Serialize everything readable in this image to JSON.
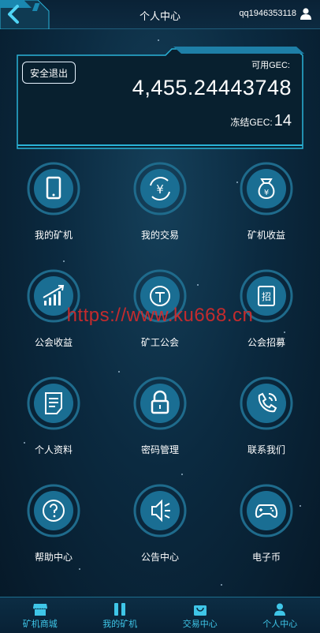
{
  "header": {
    "title": "个人中心",
    "username": "qq1946353118"
  },
  "balance": {
    "logout_label": "安全退出",
    "available_label": "可用GEC:",
    "available_value": "4,455.24443748",
    "frozen_label": "冻结GEC:",
    "frozen_value": "14"
  },
  "menu": [
    {
      "label": "我的矿机",
      "icon": "tablet-icon"
    },
    {
      "label": "我的交易",
      "icon": "yuan-exchange-icon"
    },
    {
      "label": "矿机收益",
      "icon": "money-bag-icon"
    },
    {
      "label": "公会收益",
      "icon": "growth-chart-icon"
    },
    {
      "label": "矿工公会",
      "icon": "guild-icon"
    },
    {
      "label": "公会招募",
      "icon": "recruit-icon"
    },
    {
      "label": "个人资料",
      "icon": "document-icon"
    },
    {
      "label": "密码管理",
      "icon": "lock-icon"
    },
    {
      "label": "联系我们",
      "icon": "phone-icon"
    },
    {
      "label": "帮助中心",
      "icon": "question-icon"
    },
    {
      "label": "公告中心",
      "icon": "speaker-icon"
    },
    {
      "label": "电子币",
      "icon": "gamepad-icon"
    }
  ],
  "watermark": "https://www.ku668.cn",
  "bottom_nav": [
    {
      "label": "矿机商城",
      "icon": "store-icon"
    },
    {
      "label": "我的矿机",
      "icon": "columns-icon"
    },
    {
      "label": "交易中心",
      "icon": "bag-icon"
    },
    {
      "label": "个人中心",
      "icon": "user-icon"
    }
  ],
  "colors": {
    "accent": "#3fc6e8",
    "background": "#0b2a40",
    "watermark": "#d82b2b"
  }
}
